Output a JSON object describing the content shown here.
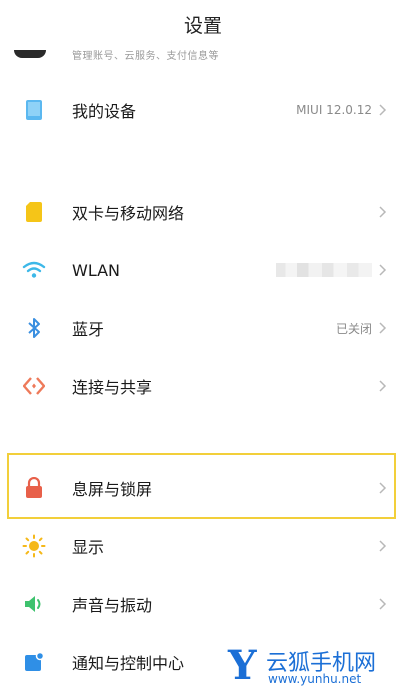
{
  "header": {
    "title": "设置"
  },
  "account": {
    "subtitle": "管理账号、云服务、支付信息等"
  },
  "items": [
    {
      "label": "我的设备",
      "value": "MIUI 12.0.12",
      "icon": "device-icon"
    },
    {
      "label": "双卡与移动网络",
      "value": "",
      "icon": "sim-card-icon"
    },
    {
      "label": "WLAN",
      "value": "",
      "icon": "wifi-icon"
    },
    {
      "label": "蓝牙",
      "value": "已关闭",
      "icon": "bluetooth-icon"
    },
    {
      "label": "连接与共享",
      "value": "",
      "icon": "share-icon"
    },
    {
      "label": "息屏与锁屏",
      "value": "",
      "icon": "lock-icon"
    },
    {
      "label": "显示",
      "value": "",
      "icon": "sun-icon"
    },
    {
      "label": "声音与振动",
      "value": "",
      "icon": "speaker-icon"
    },
    {
      "label": "通知与控制中心",
      "value": "",
      "icon": "notification-icon"
    }
  ],
  "watermark": {
    "mark": "Y",
    "name": "云狐手机网",
    "url": "www.yunhu.net"
  },
  "colors": {
    "highlight": "#f2cf3a",
    "watermark": "#1b6fd6"
  }
}
